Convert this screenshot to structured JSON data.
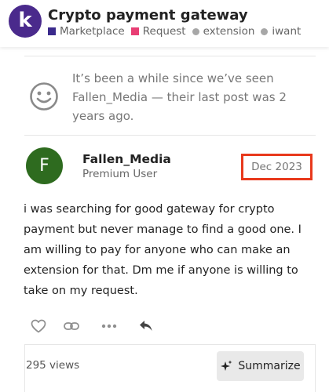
{
  "header": {
    "logo_letter": "k",
    "topic_title": "Crypto payment gateway",
    "tags": [
      {
        "label": "Marketplace",
        "color": "#3b2a8c",
        "shape": "square"
      },
      {
        "label": "Request",
        "color": "#e83e74",
        "shape": "square"
      },
      {
        "label": "extension",
        "color": "#a7a7a7",
        "shape": "dot"
      },
      {
        "label": "iwant",
        "color": "#a7a7a7",
        "shape": "dot"
      }
    ]
  },
  "notice": {
    "icon": "smile-icon",
    "text": "It’s been a while since we’ve seen Fallen_Media — their last post was 2 years ago."
  },
  "post": {
    "avatar_letter": "F",
    "avatar_color": "#2e6b1f",
    "username": "Fallen_Media",
    "user_title": "Premium User",
    "date": "Dec 2023",
    "highlight_color": "#e8391c",
    "body": "i was searching for good gateway for crypto payment but never manage to find a good one. I am willing to pay for anyone who can make an extension for that. Dm me if anyone is willing to take on my request."
  },
  "actions": [
    {
      "name": "like",
      "icon": "heart-icon"
    },
    {
      "name": "copy-link",
      "icon": "link-icon"
    },
    {
      "name": "more",
      "icon": "ellipsis-icon"
    },
    {
      "name": "reply",
      "icon": "reply-icon"
    }
  ],
  "topic_map": {
    "views": "295 views",
    "summarize_label": "Summarize",
    "summarize_icon": "sparkles-icon"
  }
}
